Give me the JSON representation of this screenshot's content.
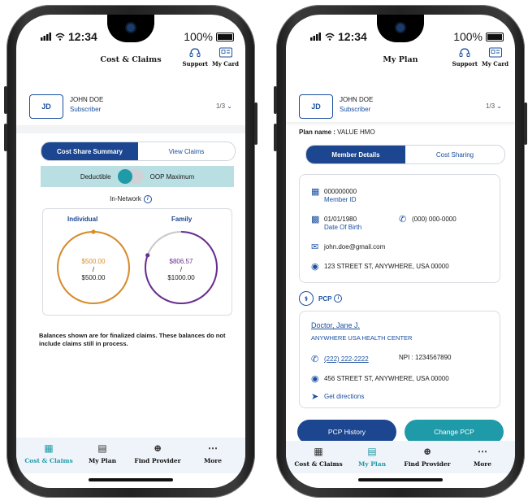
{
  "status": {
    "time": "12:34",
    "battery": "100%"
  },
  "cost_claims": {
    "header": {
      "title": "Cost & Claims",
      "support": "Support",
      "my_card": "My Card"
    },
    "member": {
      "initials": "JD",
      "name": "JOHN DOE",
      "role": "Subscriber",
      "pager": "1/3"
    },
    "tabs": [
      "Cost Share Summary",
      "View Claims"
    ],
    "toggle": {
      "left": "Deductible",
      "right": "OOP Maximum"
    },
    "network_label": "In-Network",
    "individual": {
      "label": "Individual",
      "spent": "$500.00",
      "slash": "/",
      "total": "$500.00",
      "progress": 1.0
    },
    "family": {
      "label": "Family",
      "spent": "$806.57",
      "slash": "/",
      "total": "$1000.00",
      "progress": 0.806
    },
    "note": "Balances shown are for finalized claims. These balances do not include claims still in process.",
    "colors": {
      "individual": "#d98c2b",
      "family": "#6a2e8f",
      "teal": "#1f9aa8",
      "navy": "#1c468f"
    }
  },
  "my_plan": {
    "header": {
      "title": "My Plan",
      "support": "Support",
      "my_card": "My Card"
    },
    "member": {
      "initials": "JD",
      "name": "JOHN DOE",
      "role": "Subscriber",
      "pager": "1/3"
    },
    "plan_name_label": "Plan name :",
    "plan_name_value": "VALUE HMO",
    "tabs": [
      "Member Details",
      "Cost Sharing"
    ],
    "details": {
      "member_id": "000000000",
      "member_id_label": "Member ID",
      "dob": "01/01/1980",
      "dob_label": "Date Of Birth",
      "phone": "(000) 000-0000",
      "email": "john.doe@gmail.com",
      "address": "123 STREET ST, ANYWHERE, USA 00000"
    },
    "pcp_label": "PCP",
    "pcp": {
      "doctor": "Doctor, Jane J.",
      "center": "ANYWHERE USA HEALTH CENTER",
      "phone": "(222) 222-2222",
      "npi": "NPI : 1234567890",
      "address": "456 STREET ST, ANYWHERE, USA 00000",
      "directions": "Get directions"
    },
    "buttons": {
      "history": "PCP History",
      "change": "Change PCP"
    }
  },
  "tabbar": [
    "Cost & Claims",
    "My Plan",
    "Find Provider",
    "More"
  ],
  "icons": [
    "signal-icon",
    "wifi-icon",
    "battery-icon",
    "support-headset-icon",
    "id-card-icon",
    "cost-claims-icon",
    "my-plan-icon",
    "find-provider-icon",
    "more-icon",
    "chevron-down-icon",
    "info-icon",
    "calendar-icon",
    "phone-icon",
    "email-icon",
    "location-icon",
    "stethoscope-icon",
    "directions-icon"
  ]
}
